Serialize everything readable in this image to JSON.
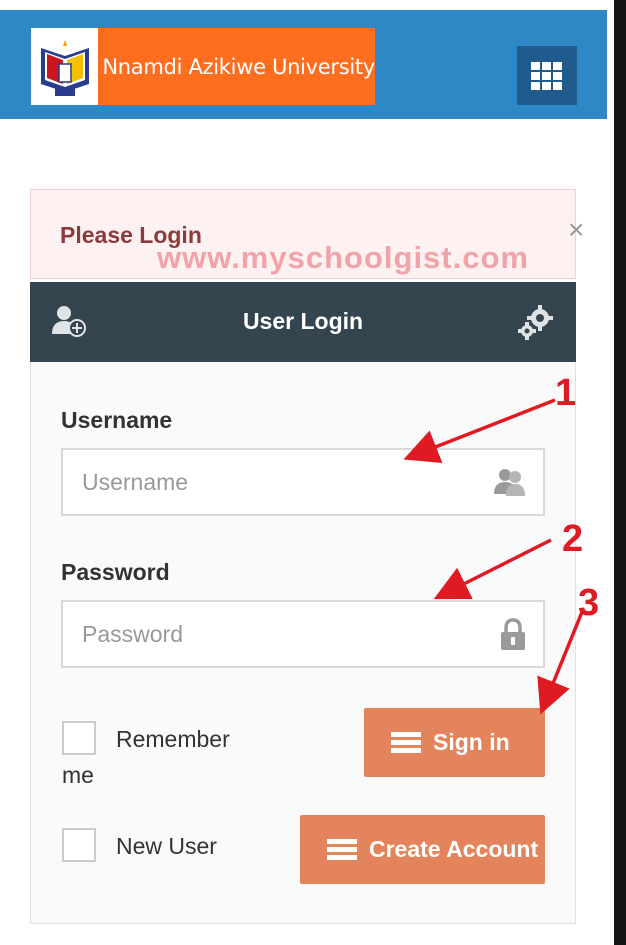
{
  "header": {
    "logo_text": "Nnamdi Azikiwe University",
    "brand_color": "#2f88c6",
    "logo_bg": "#ff6e1f",
    "menu_icon": "grid-icon"
  },
  "alert": {
    "title": "Please Login",
    "close": "×",
    "watermark": "www.myschoolgist.com"
  },
  "panel": {
    "title": "User Login",
    "left_icon": "add-user-icon",
    "right_icon": "gears-icon"
  },
  "form": {
    "username_label": "Username",
    "username_placeholder": "Username",
    "username_value": "",
    "password_label": "Password",
    "password_placeholder": "Password",
    "password_value": "",
    "remember_label_line1": "Remember",
    "remember_label_line2": "me",
    "new_user_label": "New User",
    "signin_label": "Sign in",
    "create_label": "Create Account"
  },
  "annotations": {
    "n1": "1",
    "n2": "2",
    "n3": "3",
    "color": "#e01a22"
  },
  "colors": {
    "button": "#e4845c",
    "panel_head": "#35454f"
  }
}
